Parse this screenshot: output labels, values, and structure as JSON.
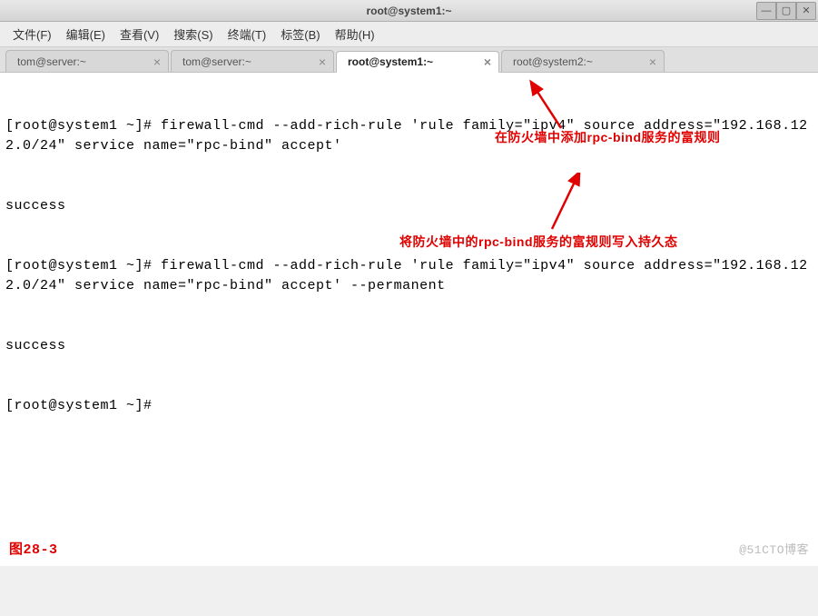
{
  "window": {
    "title": "root@system1:~",
    "controls": {
      "min": "—",
      "max": "▢",
      "close": "✕"
    }
  },
  "menubar": {
    "items": [
      "文件(F)",
      "编辑(E)",
      "查看(V)",
      "搜索(S)",
      "终端(T)",
      "标签(B)",
      "帮助(H)"
    ]
  },
  "tabs": [
    {
      "label": "tom@server:~",
      "active": false
    },
    {
      "label": "tom@server:~",
      "active": false
    },
    {
      "label": "root@system1:~",
      "active": true
    },
    {
      "label": "root@system2:~",
      "active": false
    }
  ],
  "terminal": {
    "lines": [
      "[root@system1 ~]# firewall-cmd --add-rich-rule 'rule family=\"ipv4\" source address=\"192.168.122.0/24\" service name=\"rpc-bind\" accept'",
      "success",
      "[root@system1 ~]# firewall-cmd --add-rich-rule 'rule family=\"ipv4\" source address=\"192.168.122.0/24\" service name=\"rpc-bind\" accept' --permanent",
      "success",
      "[root@system1 ~]# "
    ]
  },
  "annotations": {
    "a1": "在防火墙中添加rpc-bind服务的富规则",
    "a2": "将防火墙中的rpc-bind服务的富规则写入持久态"
  },
  "figure_label": "图28-3",
  "watermark": "@51CTO博客"
}
